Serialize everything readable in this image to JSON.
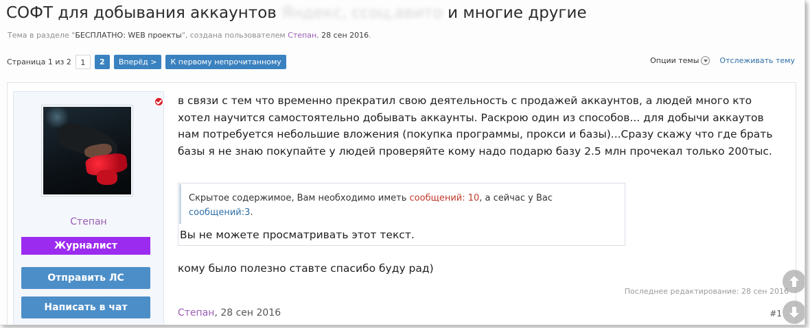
{
  "thread": {
    "title_start": "СОФТ для добывания аккаунтов",
    "title_blurred": "Яндекс, ссоц,авито",
    "title_end": "и многие другие",
    "meta_prefix": "Тема в разделе \"",
    "meta_section": "БЕСПЛАТНО: WEB проекты",
    "meta_middle": "\", создана пользователем ",
    "meta_author": "Степан",
    "meta_sep": ", ",
    "meta_date": "28 сен 2016",
    "meta_end": "."
  },
  "pager": {
    "label": "Страница 1 из 2",
    "current": "1",
    "next_page": "2",
    "forward": "Вперёд >",
    "first_unread": "К первому непрочитанному"
  },
  "tools": {
    "options": "Опции темы",
    "watch": "Отслеживать тему"
  },
  "user": {
    "name": "Степан",
    "rank": "Журналист",
    "send_pm": "Отправить ЛС",
    "write_chat": "Написать в чат"
  },
  "post": {
    "body": "в связи с тем что временно прекратил свою деятельность с продажей аккаунтов, а людей много кто хотел научится самостоятельно добывать аккаунты. Раскрою один из способов... для добычи аккаутов нам потребуется небольшие вложения (покупка программы, прокси и базы)...Сразу скажу что где брать базы я не знаю покупайте у людей проверяйте кому надо подарю базу 2.5 млн прочекал только 200тыс.",
    "hidden_prefix": "Скрытое содержимое, Вам необходимо иметь ",
    "hidden_required_label": "сообщений: 10",
    "hidden_middle": ", а сейчас у Вас ",
    "hidden_current_label": "сообщений:3",
    "hidden_end": ".",
    "cannot_view": "Вы не можете просматривать этот текст.",
    "thanks": "кому было полезно ставте спасибо буду рад)",
    "last_edit": "Последнее редактирование: 28 сен 2016",
    "footer_author": "Степан",
    "footer_date": ", 28 сен 2016",
    "permalink": "#1"
  },
  "colors": {
    "accent_blue": "#3a81bf",
    "username_purple": "#9a5cb3",
    "rank_purple": "#9c2bf0",
    "online_red": "#d6202a"
  }
}
